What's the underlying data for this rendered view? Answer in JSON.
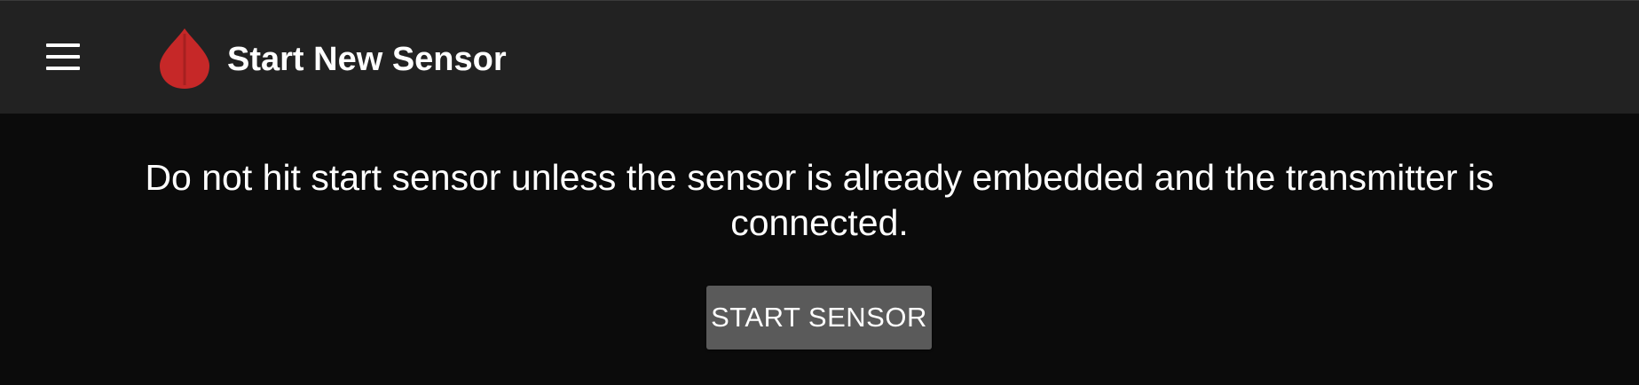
{
  "toolbar": {
    "menu_icon": "hamburger-menu-icon",
    "logo_icon": "blood-drop-icon",
    "title": "Start New Sensor"
  },
  "main": {
    "message": "Do not hit start sensor unless the sensor is already embedded and the transmitter is connected.",
    "start_button_label": "START SENSOR"
  },
  "colors": {
    "toolbar_background": "#222222",
    "content_background": "#0b0b0b",
    "logo_red": "#c62828",
    "button_background": "#5a5a5a",
    "text": "#ffffff"
  }
}
